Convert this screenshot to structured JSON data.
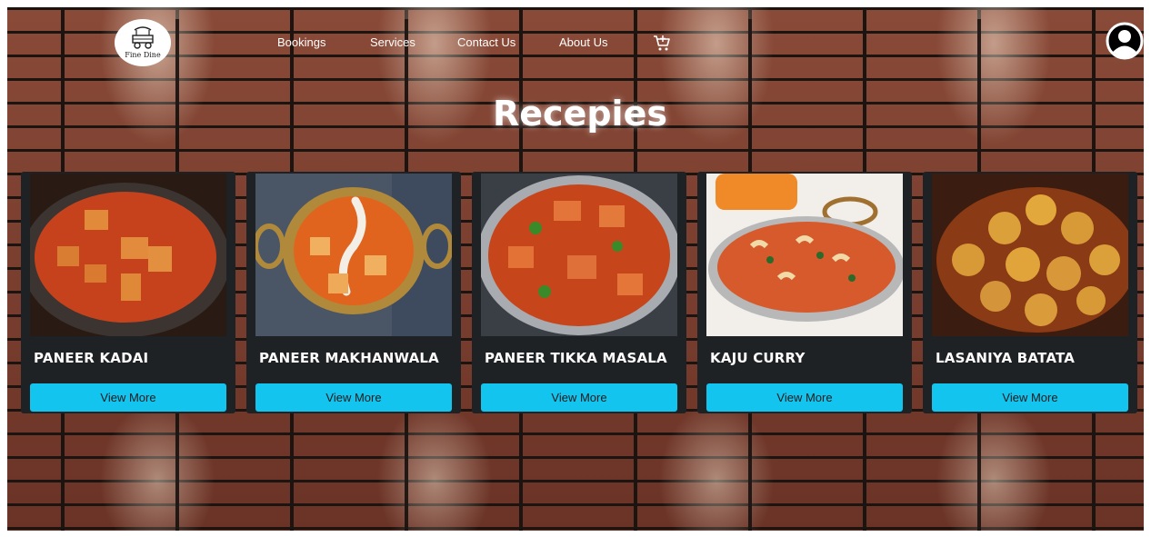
{
  "logo": {
    "text": "Fine Dine"
  },
  "nav": {
    "items": [
      {
        "label": "Bookings"
      },
      {
        "label": "Services"
      },
      {
        "label": "Contact Us"
      },
      {
        "label": "About Us"
      }
    ],
    "cart_icon": "cart-icon",
    "profile_icon": "profile-icon"
  },
  "page": {
    "title": "Recepies"
  },
  "recipes": [
    {
      "name": "PANEER KADAI",
      "button": "View More",
      "image_bg": "#2a1a14",
      "gravy": "#c6421d"
    },
    {
      "name": "PANEER MAKHANWALA",
      "button": "View More",
      "image_bg": "#4a5566",
      "gravy": "#e0641e"
    },
    {
      "name": "PANEER TIKKA MASALA",
      "button": "View More",
      "image_bg": "#3a3f46",
      "gravy": "#c7451b"
    },
    {
      "name": "KAJU CURRY",
      "button": "View More",
      "image_bg": "#f2efeb",
      "gravy": "#d65a2b"
    },
    {
      "name": "LASANIYA BATATA",
      "button": "View More",
      "image_bg": "#3a1c10",
      "gravy": "#b8581a"
    }
  ],
  "colors": {
    "accent": "#13c4ee",
    "card_bg": "#1f2225"
  }
}
